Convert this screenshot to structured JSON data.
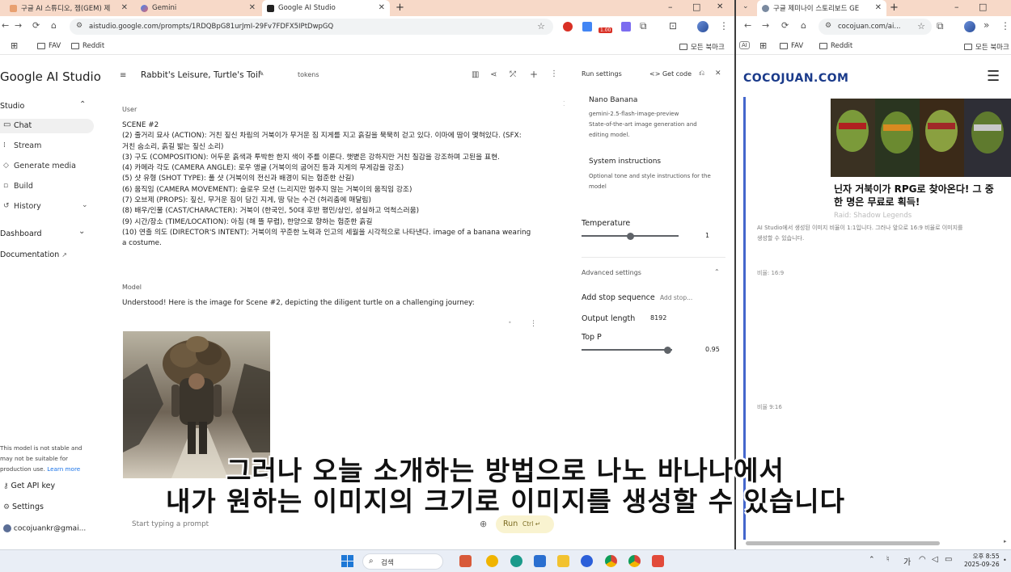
{
  "left_browser": {
    "tabs": [
      {
        "label": "구글 AI 스튜디오, 젬(GEM) 제"
      },
      {
        "label": "Gemini"
      },
      {
        "label": "Google AI Studio"
      }
    ],
    "new_tab": "+",
    "window_controls": {
      "minimize": "–",
      "maximize": "□",
      "close": "✕"
    },
    "url": "aistudio.google.com/prompts/1RDQBpG81urJmI-29Fv7FDFX5IPtDwpGQ",
    "extension_badge": "1.00",
    "bookmarks": [
      {
        "label": "FAV"
      },
      {
        "label": "Reddit"
      }
    ],
    "all_bookmarks": "모든 북마크"
  },
  "studio": {
    "logo": "Google AI Studio",
    "title": "Rabbit's Leisure, Turtle's Toil",
    "tokens_label": "tokens",
    "sidebar": {
      "section_studio": "Studio",
      "items": [
        {
          "label": "Chat",
          "icon": "chat-icon"
        },
        {
          "label": "Stream",
          "icon": "stream-icon"
        },
        {
          "label": "Generate media",
          "icon": "media-icon"
        },
        {
          "label": "Build",
          "icon": "build-icon"
        },
        {
          "label": "History",
          "icon": "history-icon"
        }
      ],
      "section_dashboard": "Dashboard",
      "documentation": "Documentation",
      "notice": [
        "This model is not stable and",
        "may not be suitable for",
        "production use."
      ],
      "learn_more": "Learn more",
      "get_api_key": "Get API key",
      "settings": "Settings",
      "account": "cocojuankr@gmai..."
    },
    "chat": {
      "user_role": "User",
      "user_lines": [
        "SCENE #2",
        "(2) 줄거리 묘사 (ACTION): 거친 짚신 차림의 거북이가 무거운 짐 지게를 지고 흙길을 묵묵히 걷고 있다. 이마에 땀이 맺혀있다. (SFX:",
        "거친 숨소리, 흙길 밟는 짚신 소리)",
        "(3) 구도 (COMPOSITION): 어두운 흙색과 투박한 한지 색이 주를 이룬다. 햇볕은 강하지만 거친 질감을 강조하며 고된을 표현.",
        "(4) 카메라 각도 (CAMERA ANGLE): 로우 앵글 (거북이의 굽어진 등과 지게의 무게감을 강조)",
        "(5) 샷 유형 (SHOT TYPE): 풀 샷 (거북이의 전신과 배경이 되는 험준한 산길)",
        "(6) 움직임 (CAMERA MOVEMENT): 슬로우 모션 (느리지만 멈추지 않는 거북이의 움직임 강조)",
        "(7) 오브제 (PROPS): 짚신, 무거운 짐이 담긴 지게, 땀 닦는 수건 (허리춤에 매달림)",
        "(8) 배우/인물 (CAST/CHARACTER): 거북이 (한국인, 50대 후반 평민/상인, 성실하고 억척스러움)",
        "(9) 시간/장소 (TIME/LOCATION): 아침 (해 뜰 무렵), 한양으로 향하는 험준한 흙길",
        "(10) 연출 의도 (DIRECTOR'S INTENT): 거북이의 꾸준한 노력과 인고의 세월을 시각적으로 나타낸다. image of a banana wearing",
        "a costume."
      ],
      "model_role": "Model",
      "model_text": "Understood! Here is the image for Scene #2, depicting the diligent turtle on a challenging journey:",
      "input_placeholder": "Start typing a prompt",
      "run_label": "Run",
      "run_shortcut": "Ctrl"
    },
    "run_settings": {
      "title": "Run settings",
      "get_code": "Get code",
      "model_name": "Nano Banana",
      "model_id": "gemini-2.5-flash-image-preview",
      "model_desc": [
        "State-of-the-art image generation and",
        "editing model."
      ],
      "system_instructions": "System instructions",
      "system_desc": [
        "Optional tone and style instructions for the",
        "model"
      ],
      "temperature_label": "Temperature",
      "temperature_value": "1",
      "temperature": 1,
      "temperature_max": 2,
      "advanced": "Advanced settings",
      "stop_sequence_label": "Add stop sequence",
      "stop_sequence_placeholder": "Add stop...",
      "output_length_label": "Output length",
      "output_length_value": "8192",
      "top_p_label": "Top P",
      "top_p_value": "0.95",
      "top_p": 0.95
    }
  },
  "right_browser": {
    "tab_label": "구글 제미나이 스토리보드 GE",
    "url": "cocojuan.com/ai...",
    "bookmarks": [
      {
        "label": "FAV"
      },
      {
        "label": "Reddit"
      }
    ],
    "all_bookmarks": "모든 북마크",
    "site_logo": "COCOJUAN.COM",
    "ad_headline": [
      "닌자 거북이가 RPG로 찾아온다! 그 중",
      "한 명은 무료로 획득!"
    ],
    "ad_source": "Raid: Shadow Legends",
    "body_text": [
      "AI Studio에서 생성된 이미지 비율이 1:1입니다. 그러나 앞으로 16:9 비율로 이미지를",
      "생성할 수 있습니다."
    ],
    "ratio_16_9": "비율: 16:9",
    "ratio_9_16": "비율 9:16"
  },
  "subtitles": [
    "그러나 오늘 소개하는 방법으로 나노 바나나에서",
    "내가 원하는 이미지의 크기로 이미지를 생성할 수 있습니다"
  ],
  "taskbar": {
    "search_label": "검색",
    "ime_label": "가",
    "time": "오후 8:55",
    "date": "2025-09-26"
  }
}
